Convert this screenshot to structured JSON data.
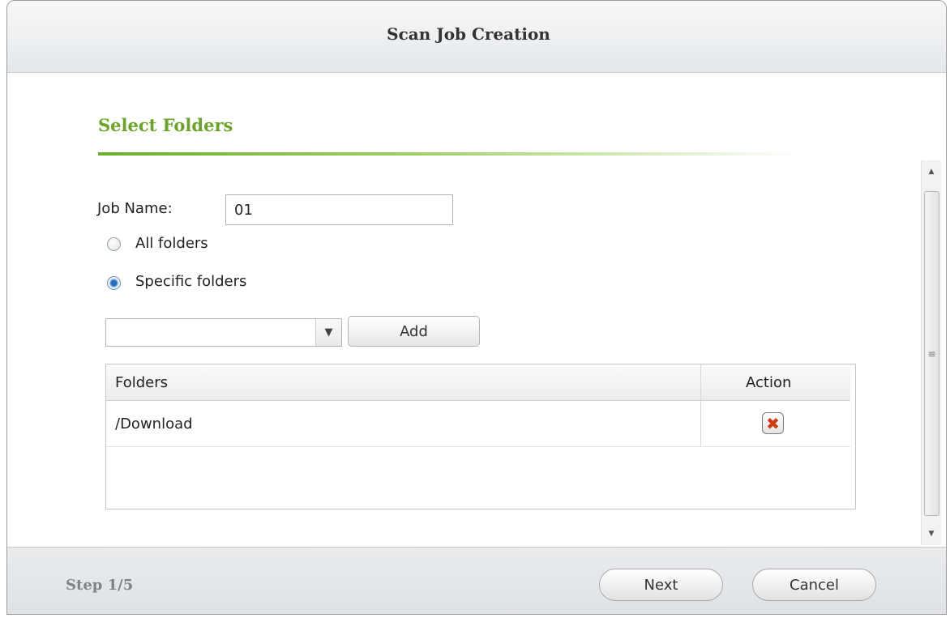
{
  "dialog": {
    "title": "Scan Job Creation"
  },
  "section": {
    "title": "Select Folders"
  },
  "form": {
    "job_name_label": "Job Name:",
    "job_name_value": "01",
    "radio_all_label": "All folders",
    "radio_specific_label": "Specific folders",
    "selected_option": "Specific folders",
    "folder_select_value": "",
    "add_label": "Add"
  },
  "folders_table": {
    "columns": [
      "Folders",
      "Action"
    ],
    "rows": [
      {
        "folder": "/Download",
        "action_icon": "delete-icon"
      }
    ]
  },
  "footer": {
    "step": "Step 1/5",
    "next_label": "Next",
    "cancel_label": "Cancel"
  },
  "colors": {
    "section_title": "#6aa525",
    "delete_icon": "#d43a12"
  }
}
